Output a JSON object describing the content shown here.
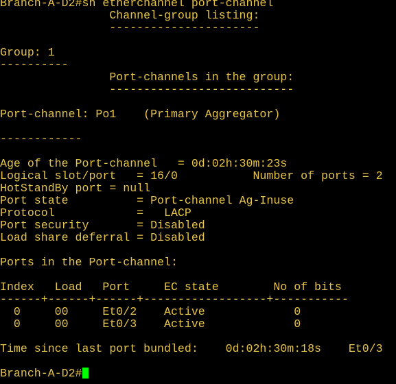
{
  "terminal": {
    "colors": {
      "background": "#000000",
      "text": "#e6c34a",
      "cursor": "#00ff00"
    },
    "lines": [
      "Branch-A-D2#sh etherchannel port-channel",
      "                Channel-group listing:",
      "                ----------------------",
      "",
      "Group: 1",
      "----------",
      "                Port-channels in the group:",
      "                ---------------------------",
      "",
      "Port-channel: Po1    (Primary Aggregator)",
      "",
      "------------",
      "",
      "Age of the Port-channel   = 0d:02h:30m:23s",
      "Logical slot/port   = 16/0           Number of ports = 2",
      "HotStandBy port = null",
      "Port state          = Port-channel Ag-Inuse",
      "Protocol            =   LACP",
      "Port security       = Disabled",
      "Load share deferral = Disabled",
      "",
      "Ports in the Port-channel:",
      "",
      "Index   Load   Port     EC state        No of bits",
      "------+------+------+------------------+-----------",
      "  0     00     Et0/2    Active             0",
      "  0     00     Et0/3    Active             0",
      "",
      "Time since last port bundled:    0d:02h:30m:18s    Et0/3",
      "",
      "Branch-A-D2#"
    ],
    "cursor_icon": "block-cursor"
  }
}
